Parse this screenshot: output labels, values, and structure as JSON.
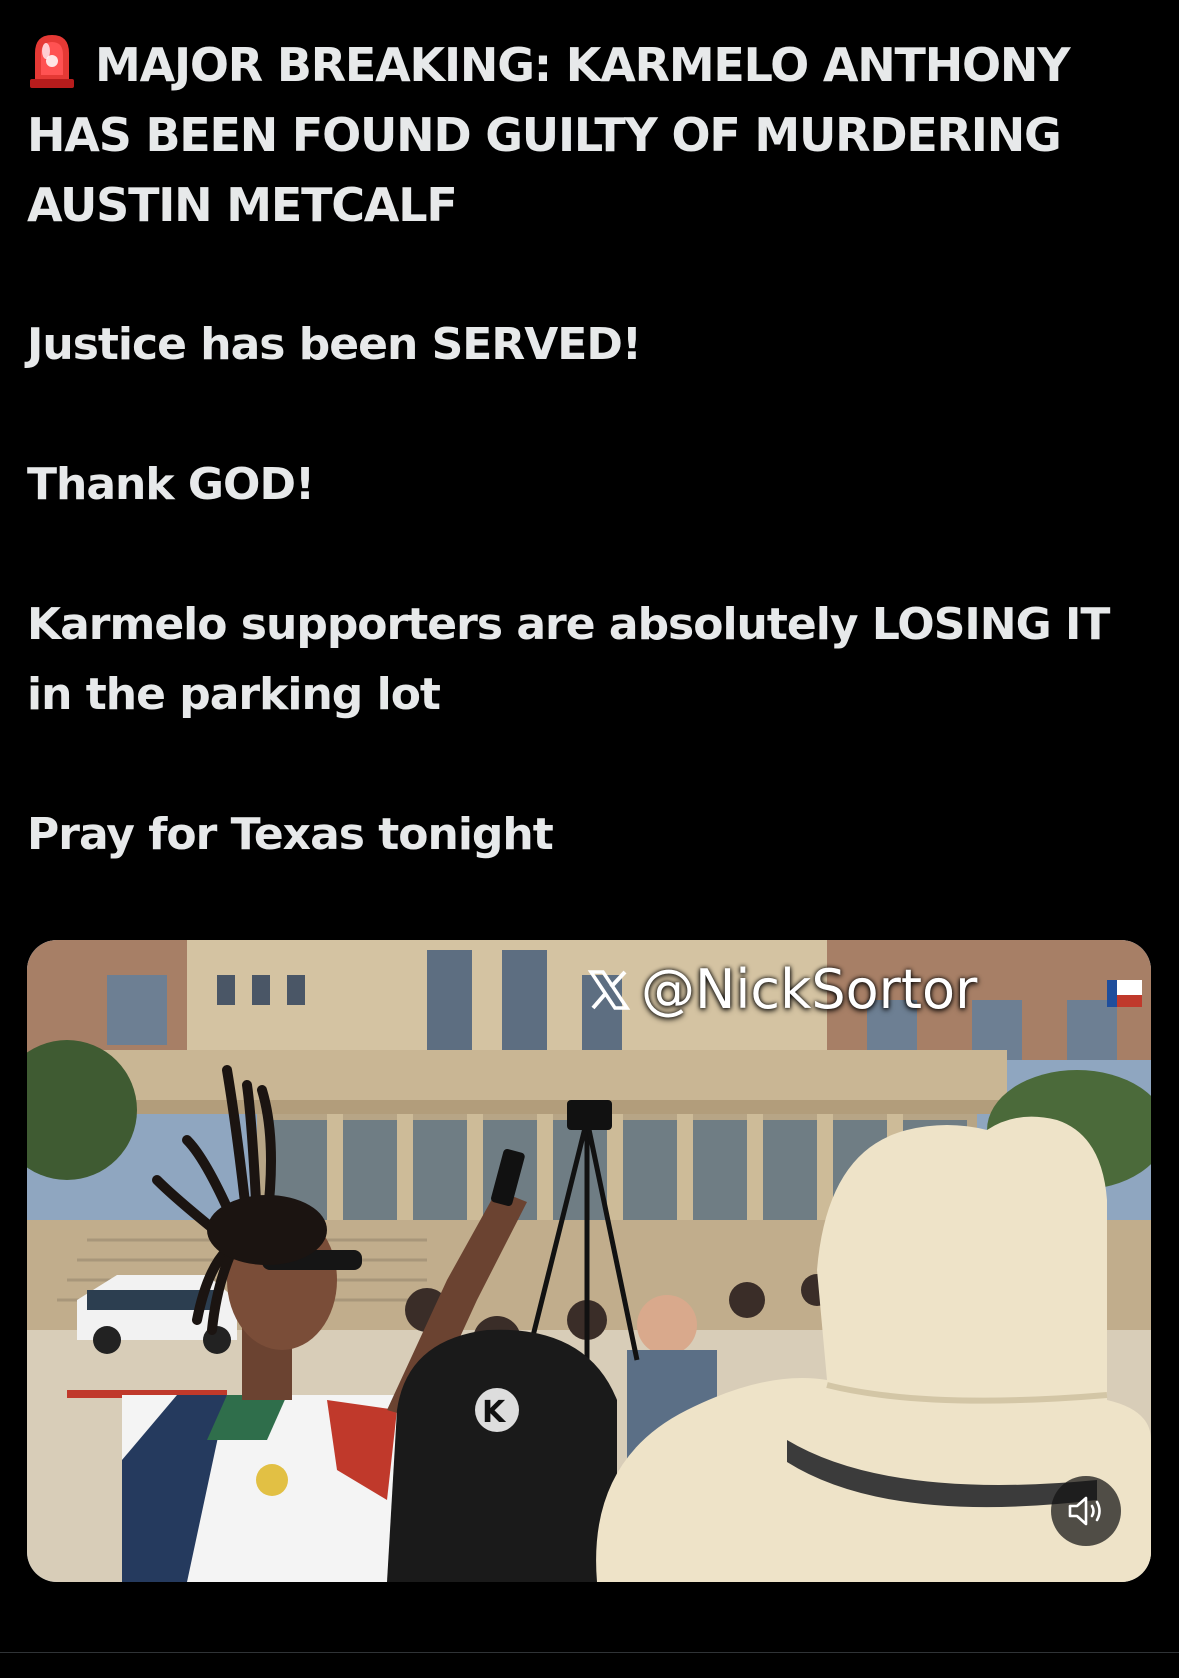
{
  "post": {
    "headline": "MAJOR BREAKING: KARMELO ANTHONY HAS BEEN FOUND GUILTY OF MURDERING AUSTIN METCALF",
    "headline_icon": "police-siren-emoji",
    "line_2": "Justice has been SERVED!",
    "line_3": "Thank GOD!",
    "line_4": "Karmelo supporters are absolutely LOSING IT in the parking lot",
    "line_5": "Pray for Texas tonight"
  },
  "media": {
    "type": "video",
    "watermark_handle": "@NickSortor",
    "watermark_icon": "x-logo-icon",
    "mute_icon": "speaker-muted-icon"
  },
  "colors": {
    "background": "#000000",
    "text": "#e7e9ea",
    "divider": "#2f3336"
  }
}
